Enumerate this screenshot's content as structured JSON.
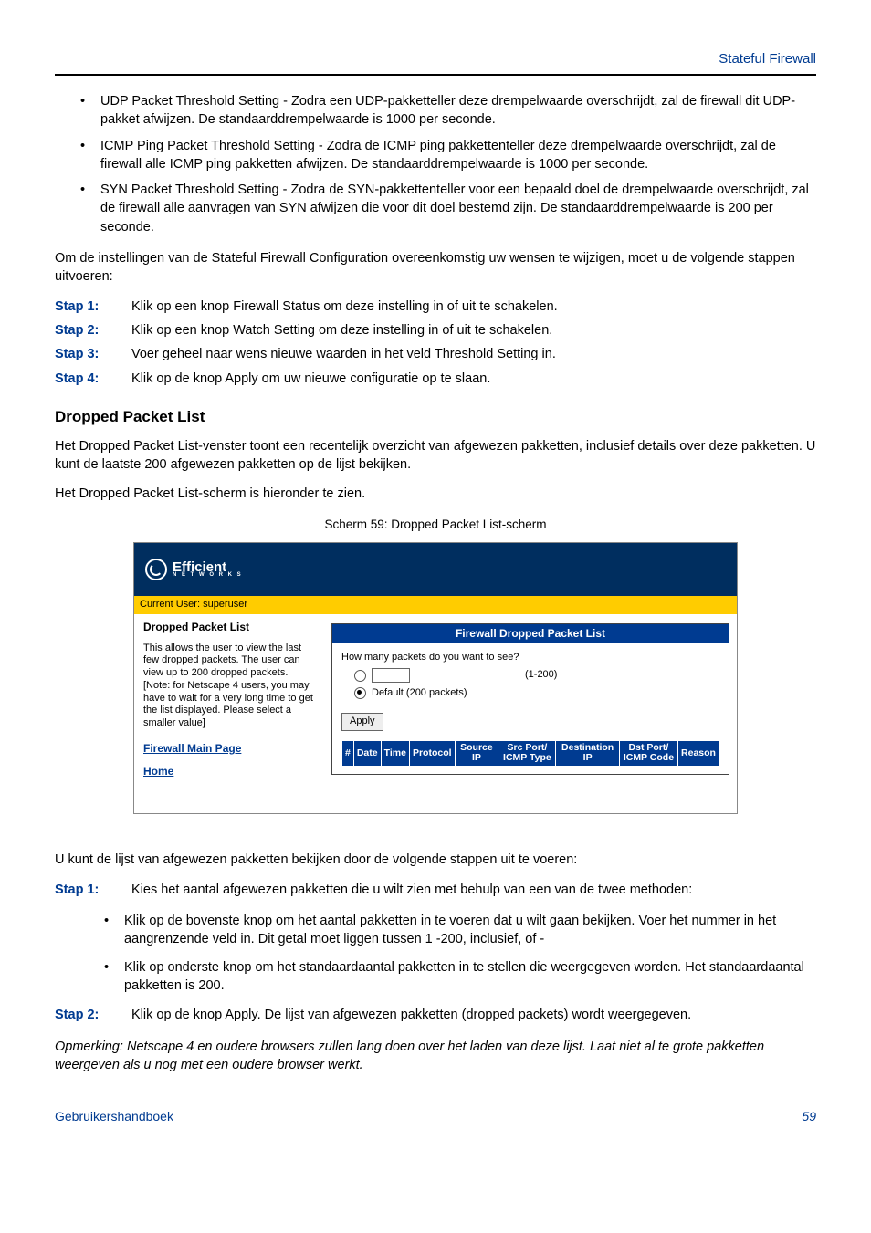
{
  "header": {
    "title": "Stateful Firewall"
  },
  "bullets_top": [
    "UDP Packet Threshold Setting - Zodra een UDP-pakketteller deze drempelwaarde overschrijdt, zal de firewall dit UDP-pakket afwijzen. De standaarddrempelwaarde is 1000 per seconde.",
    "ICMP Ping Packet Threshold Setting - Zodra de ICMP ping pakkettenteller deze drempelwaarde overschrijdt, zal de firewall alle ICMP ping pakketten afwijzen. De standaarddrempelwaarde is 1000 per seconde.",
    "SYN Packet Threshold Setting - Zodra de SYN-pakkettenteller voor een bepaald doel de drempelwaarde overschrijdt, zal de firewall alle aanvragen van SYN afwijzen die voor dit doel bestemd zijn. De standaarddrempelwaarde is 200 per seconde."
  ],
  "intro1": "Om de instellingen van de Stateful Firewall Configuration overeenkomstig uw wensen te wijzigen, moet u de volgende stappen uitvoeren:",
  "steps1": [
    {
      "label": "Stap 1:",
      "text": "Klik op een knop Firewall Status om deze instelling in of uit te schakelen."
    },
    {
      "label": "Stap 2:",
      "text": "Klik op een knop Watch Setting om deze instelling in of uit te schakelen."
    },
    {
      "label": "Stap 3:",
      "text": "Voer geheel naar wens nieuwe waarden in het veld Threshold Setting in."
    },
    {
      "label": "Stap 4:",
      "text": "Klik op de knop Apply om uw nieuwe configuratie op te slaan."
    }
  ],
  "section_title": "Dropped Packet List",
  "para1": "Het Dropped Packet List-venster toont een recentelijk overzicht van afgewezen pakketten, inclusief details over deze pakketten. U kunt de laatste 200 afgewezen pakketten op de lijst bekijken.",
  "para2": "Het Dropped Packet List-scherm is hieronder te zien.",
  "figure_caption": "Scherm 59: Dropped Packet List-scherm",
  "shot": {
    "logo_main": "Efficient",
    "logo_sub": "N E T W O R K S",
    "current_user": "Current User: superuser",
    "side_title": "Dropped Packet List",
    "side_desc": "This allows the user to view the last few dropped packets. The user can view up to 200 dropped packets. [Note: for Netscape 4 users, you may have to wait for a very long time to get the list displayed. Please select a smaller value]",
    "side_link1": "Firewall Main Page",
    "side_link2": "Home",
    "panel_title": "Firewall Dropped Packet List",
    "panel_q": "How many packets do you want to see?",
    "range_hint": "(1-200)",
    "default_label": "Default (200 packets)",
    "apply_label": "Apply",
    "cols": [
      "#",
      "Date",
      "Time",
      "Protocol",
      "Source IP",
      "Src Port/\nICMP Type",
      "Destination IP",
      "Dst Port/\nICMP Code",
      "Reason"
    ]
  },
  "intro2": "U kunt de lijst van afgewezen pakketten bekijken door de volgende stappen uit te voeren:",
  "steps2": [
    {
      "label": "Stap 1:",
      "text": "Kies het aantal afgewezen pakketten die u wilt zien met behulp van een van de twee methoden:"
    }
  ],
  "sub_bullets": [
    "Klik op de bovenste knop om het aantal pakketten in te voeren dat u wilt gaan bekijken. Voer het nummer in het aangrenzende veld in. Dit getal moet liggen tussen 1 -200, inclusief, of -",
    "Klik op onderste knop om het standaardaantal pakketten in te stellen die weergegeven  worden. Het standaardaantal pakketten is 200."
  ],
  "steps3": [
    {
      "label": "Stap 2:",
      "text": "Klik op de knop Apply. De lijst van afgewezen pakketten (dropped packets) wordt weergegeven."
    }
  ],
  "note": "Opmerking: Netscape 4 en oudere browsers zullen lang doen over het laden van deze lijst. Laat niet al te grote pakketten weergeven als u nog met een oudere browser werkt.",
  "footer": {
    "left": "Gebruikershandboek",
    "page": "59"
  }
}
